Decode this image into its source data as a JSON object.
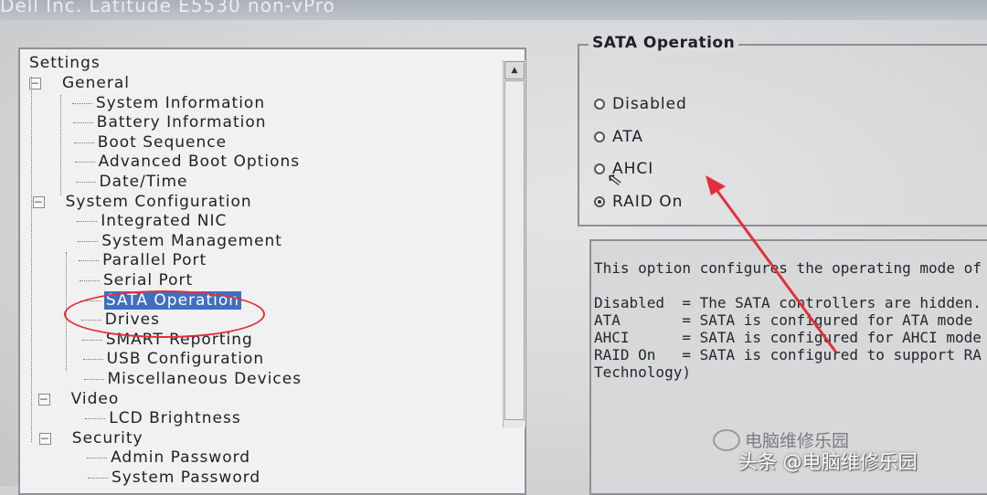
{
  "window": {
    "title": "Dell Inc. Latitude E5530 non-vPro"
  },
  "tree": {
    "root": "Settings",
    "items": [
      {
        "label": "General",
        "level": 0
      },
      {
        "label": "System Information",
        "level": 1
      },
      {
        "label": "Battery Information",
        "level": 1
      },
      {
        "label": "Boot Sequence",
        "level": 1
      },
      {
        "label": "Advanced Boot Options",
        "level": 1
      },
      {
        "label": "Date/Time",
        "level": 1
      },
      {
        "label": "System Configuration",
        "level": 0
      },
      {
        "label": "Integrated NIC",
        "level": 1
      },
      {
        "label": "System Management",
        "level": 1
      },
      {
        "label": "Parallel Port",
        "level": 1
      },
      {
        "label": "Serial Port",
        "level": 1
      },
      {
        "label": "SATA Operation",
        "level": 1,
        "selected": true
      },
      {
        "label": "Drives",
        "level": 1
      },
      {
        "label": "SMART Reporting",
        "level": 1
      },
      {
        "label": "USB Configuration",
        "level": 1
      },
      {
        "label": "Miscellaneous Devices",
        "level": 1
      },
      {
        "label": "Video",
        "level": 0
      },
      {
        "label": "LCD Brightness",
        "level": 1
      },
      {
        "label": "Security",
        "level": 0
      },
      {
        "label": "Admin Password",
        "level": 1
      },
      {
        "label": "System Password",
        "level": 1
      }
    ]
  },
  "sata": {
    "group_title": "SATA Operation",
    "options": [
      {
        "label": "Disabled",
        "selected": false
      },
      {
        "label": "ATA",
        "selected": false
      },
      {
        "label": "AHCI",
        "selected": false
      },
      {
        "label": "RAID On",
        "selected": true
      }
    ]
  },
  "description": {
    "intro": "This option configures the operating mode of",
    "lines": [
      "Disabled  = The SATA controllers are hidden.",
      "ATA       = SATA is configured for ATA mode",
      "AHCI      = SATA is configured for AHCI mode",
      "RAID On   = SATA is configured to support RA",
      "Technology)"
    ]
  },
  "watermark": {
    "logo_text": "电脑维修乐园",
    "credit": "头条 @电脑维修乐园"
  },
  "colors": {
    "selection": "#3f6fc2",
    "annotation": "#e2303a"
  },
  "icons": {
    "scroll_up": "triangle-up",
    "expander": "minus-box",
    "cursor": "mouse-pointer"
  }
}
